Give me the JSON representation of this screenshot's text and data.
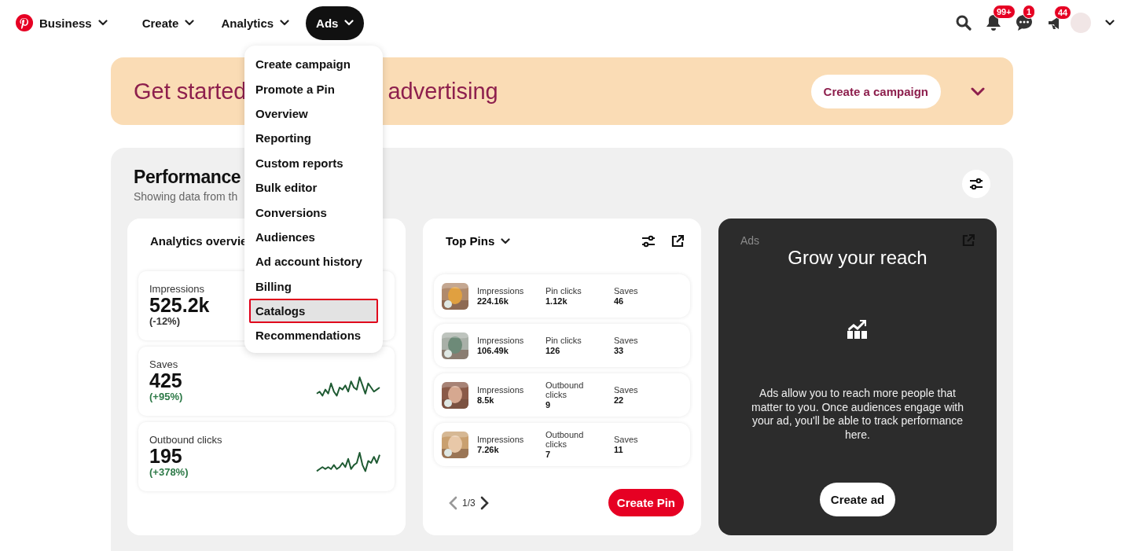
{
  "nav": {
    "items": [
      {
        "label": "Business",
        "selected": false
      },
      {
        "label": "Create",
        "selected": false
      },
      {
        "label": "Analytics",
        "selected": false
      },
      {
        "label": "Ads",
        "selected": true
      }
    ]
  },
  "notifications": [
    {
      "kind": "bell",
      "badge": "99+"
    },
    {
      "kind": "chat",
      "badge": "1"
    },
    {
      "kind": "megaphone",
      "badge": "44"
    }
  ],
  "ads_menu": [
    {
      "label": "Create campaign",
      "selected": false
    },
    {
      "label": "Promote a Pin",
      "selected": false
    },
    {
      "label": "Overview",
      "selected": false
    },
    {
      "label": "Reporting",
      "selected": false
    },
    {
      "label": "Custom reports",
      "selected": false
    },
    {
      "label": "Bulk editor",
      "selected": false
    },
    {
      "label": "Conversions",
      "selected": false
    },
    {
      "label": "Audiences",
      "selected": false
    },
    {
      "label": "Ad account history",
      "selected": false
    },
    {
      "label": "Billing",
      "selected": false
    },
    {
      "label": "Catalogs",
      "selected": true
    },
    {
      "label": "Recommendations",
      "selected": false
    }
  ],
  "banner": {
    "title_start": "Get started",
    "title_end": "advertising",
    "button": "Create a campaign"
  },
  "performance": {
    "title": "Performance",
    "subtitle": "Showing data from th",
    "analytics": {
      "title": "Analytics overvie",
      "metrics": [
        {
          "label": "Impressions",
          "value": "525.2k",
          "change": "(-12%)",
          "positive": false,
          "kind": "plain"
        },
        {
          "label": "Saves",
          "value": "425",
          "change": "(+95%)",
          "positive": true,
          "kind": "sparkline"
        },
        {
          "label": "Outbound clicks",
          "value": "195",
          "change": "(+378%)",
          "positive": true,
          "kind": "sparkline"
        }
      ]
    },
    "top_pins": {
      "title": "Top Pins",
      "rows": [
        {
          "stats": [
            {
              "label": "Impressions",
              "value": "224.16k"
            },
            {
              "label": "Pin clicks",
              "value": "1.12k"
            },
            {
              "label": "Saves",
              "value": "46"
            }
          ]
        },
        {
          "stats": [
            {
              "label": "Impressions",
              "value": "106.49k"
            },
            {
              "label": "Pin clicks",
              "value": "126"
            },
            {
              "label": "Saves",
              "value": "33"
            }
          ]
        },
        {
          "stats": [
            {
              "label": "Impressions",
              "value": "8.5k"
            },
            {
              "label": "Outbound clicks",
              "value": "9"
            },
            {
              "label": "Saves",
              "value": "22"
            }
          ]
        },
        {
          "stats": [
            {
              "label": "Impressions",
              "value": "7.26k"
            },
            {
              "label": "Outbound clicks",
              "value": "7"
            },
            {
              "label": "Saves",
              "value": "11"
            }
          ]
        }
      ],
      "page": "1/3",
      "button": "Create Pin"
    },
    "ads_card": {
      "label": "Ads",
      "title": "Grow your reach",
      "body": "Ads allow you to reach more people that matter to you. Once audiences engage with your ad, you'll be able to track performance here.",
      "button": "Create ad"
    }
  }
}
